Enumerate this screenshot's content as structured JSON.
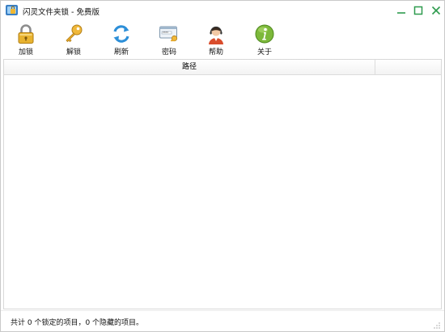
{
  "window": {
    "title": "闪灵文件夹锁 - 免费版",
    "controls": {
      "minimize_icon": "minimize-icon",
      "maximize_icon": "maximize-icon",
      "close_icon": "close-icon"
    },
    "accent_color": "#2e9b4e"
  },
  "toolbar": {
    "items": [
      {
        "label": "加锁",
        "icon": "padlock-icon"
      },
      {
        "label": "解锁",
        "icon": "key-icon"
      },
      {
        "label": "刷新",
        "icon": "refresh-icon"
      },
      {
        "label": "密码",
        "icon": "password-card-icon"
      },
      {
        "label": "帮助",
        "icon": "support-agent-icon"
      },
      {
        "label": "关于",
        "icon": "info-icon"
      }
    ]
  },
  "list": {
    "columns": [
      "路径",
      ""
    ],
    "rows": []
  },
  "status": {
    "text": "共计 0 个锁定的项目，0 个隐藏的项目。"
  }
}
